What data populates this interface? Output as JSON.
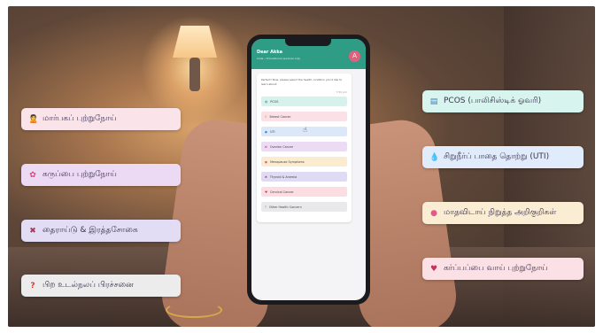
{
  "left_pills": [
    {
      "icon": "female-icon",
      "glyph": "🙎",
      "label": "மார்பகப் புற்றுநோய்",
      "bg": "#fbe3ea"
    },
    {
      "icon": "flower-icon",
      "glyph": "✿",
      "label": "கருப்பை புற்றுநோய்",
      "bg": "#ecd9f3"
    },
    {
      "icon": "butterfly-icon",
      "glyph": "✖",
      "label": "தைராய்டு & இரத்தசோகை",
      "bg": "#e2dcf5"
    },
    {
      "icon": "question-icon",
      "glyph": "?",
      "label": "பிற உடல்நலப் பிரச்சனை",
      "bg": "#ececec"
    }
  ],
  "right_pills": [
    {
      "icon": "document-icon",
      "glyph": "▤",
      "label": "PCOS (பாலிசிஸ்டிக் ஓவரி)",
      "bg": "#d8f4ee"
    },
    {
      "icon": "droplet-icon",
      "glyph": "💧",
      "label": "சிறுநீர்ப் பாதை தொற்று (UTI)",
      "bg": "#e0ecfb"
    },
    {
      "icon": "circle-icon",
      "glyph": "●",
      "label": "மாதவிடாய் நிறுத்த அறிகுறிகள்",
      "bg": "#fbecd4"
    },
    {
      "icon": "heart-icon",
      "glyph": "♥",
      "label": "கர்ப்பப்பை வாய் புற்றுநோய்",
      "bg": "#fbe0e5"
    }
  ],
  "app": {
    "title": "Dear Akka",
    "subtitle": "India • Educational purpose only",
    "avatar": "A",
    "message": "Perfect! Now, please select the health condition you'd like to learn about:",
    "time": "7:50 pm",
    "options": [
      {
        "label": "PCOS",
        "icon": "document-icon",
        "glyph": "▤",
        "bg": "#d6f2ec"
      },
      {
        "label": "Breast Cancer",
        "icon": "female-icon",
        "glyph": "♀",
        "bg": "#fbe0e8"
      },
      {
        "label": "UTI",
        "icon": "droplet-icon",
        "glyph": "●",
        "bg": "#dbe8fa"
      },
      {
        "label": "Ovarian Cancer",
        "icon": "flower-icon",
        "glyph": "✿",
        "bg": "#ecdcf3"
      },
      {
        "label": "Menopause Symptoms",
        "icon": "circle-icon",
        "glyph": "●",
        "bg": "#fbeccf"
      },
      {
        "label": "Thyroid & Anemia",
        "icon": "butterfly-icon",
        "glyph": "✖",
        "bg": "#e0dbf4"
      },
      {
        "label": "Cervical Cancer",
        "icon": "heart-icon",
        "glyph": "♥",
        "bg": "#fbdde2"
      },
      {
        "label": "Other Health Concern",
        "icon": "question-icon",
        "glyph": "?",
        "bg": "#e9e9ec"
      }
    ]
  }
}
